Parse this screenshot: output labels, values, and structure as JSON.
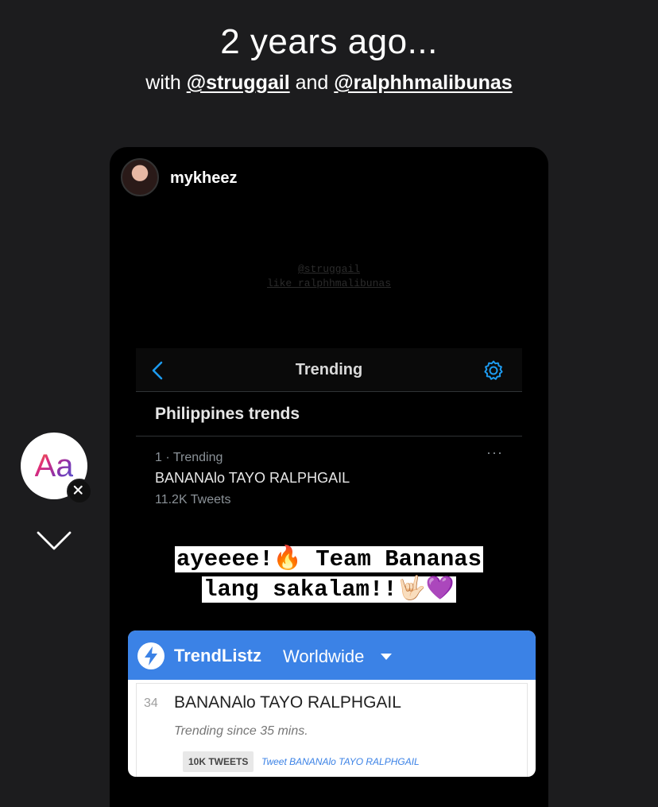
{
  "header": {
    "title": "2 years ago...",
    "with_prefix": "with ",
    "mention1": "@struggail",
    "and_text": " and ",
    "mention2": "@ralphhmalibunas"
  },
  "story": {
    "username": "mykheez",
    "ghost_line1": "@struggail",
    "ghost_line2": "like ralphhmalibunas"
  },
  "trending_card": {
    "title": "Trending",
    "region": "Philippines trends",
    "item": {
      "meta": "1 · Trending",
      "name": "BANANAlo TAYO RALPHGAIL",
      "count": "11.2K Tweets",
      "more": "···"
    }
  },
  "caption": {
    "line1": "ayeeee!🔥 Team Bananas",
    "line2": "lang sakalam!!🤟🏻💜"
  },
  "trendlistz": {
    "brand": "TrendListz",
    "region": "Worldwide",
    "rank": "34",
    "name": "BANANAlo TAYO RALPHGAIL",
    "since": "Trending since 35 mins.",
    "tweets_badge": "10K TWEETS",
    "tweet_link": "Tweet BANANAlo TAYO RALPHGAIL"
  },
  "tools": {
    "text_tool": "Aa"
  },
  "colors": {
    "background": "#1c1c1e",
    "twitter_blue": "#1d9bf0",
    "trendlistz_blue": "#3b82e6"
  }
}
